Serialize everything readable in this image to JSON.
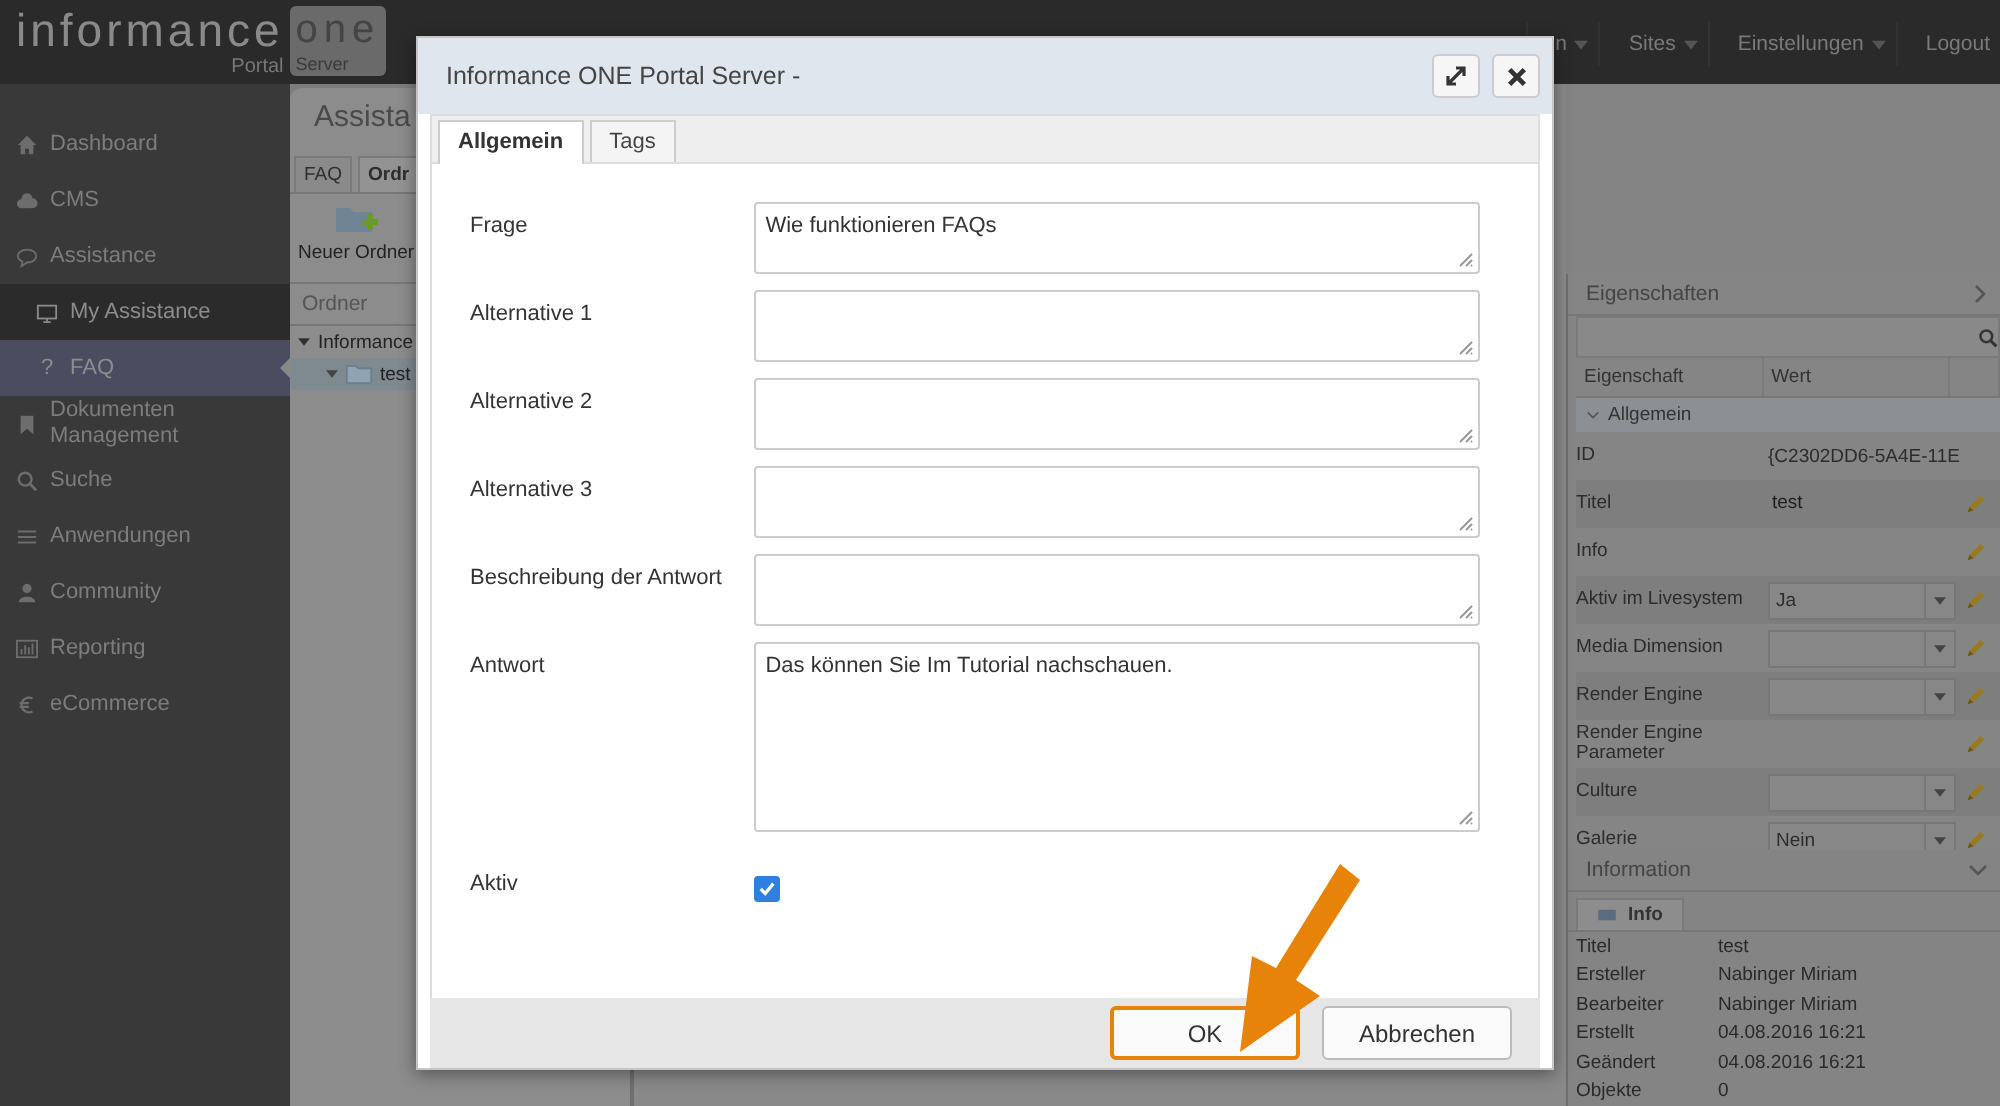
{
  "header": {
    "logo": {
      "brand": "informance",
      "one": "one",
      "portal": "Portal",
      "server": "Server"
    },
    "nav": [
      {
        "label": "n",
        "dropdown": true
      },
      {
        "label": "Sites",
        "dropdown": true
      },
      {
        "label": "Einstellungen",
        "dropdown": true
      },
      {
        "label": "Logout",
        "dropdown": false
      }
    ]
  },
  "sidebar": {
    "items": [
      {
        "label": "Dashboard",
        "selected": false
      },
      {
        "label": "CMS",
        "selected": false
      },
      {
        "label": "Assistance",
        "selected": false,
        "children": [
          {
            "label": "My Assistance",
            "selected": false
          },
          {
            "label": "FAQ",
            "icon_text": "?",
            "selected": true
          }
        ]
      },
      {
        "label": "Dokumenten Management",
        "selected": false
      },
      {
        "label": "Suche",
        "selected": false
      },
      {
        "label": "Anwendungen",
        "selected": false
      },
      {
        "label": "Community",
        "selected": false
      },
      {
        "label": "Reporting",
        "selected": false
      },
      {
        "label": "eCommerce",
        "selected": false
      }
    ]
  },
  "module": {
    "title": "Assista",
    "tabs": [
      {
        "label": "FAQ",
        "selected": false
      },
      {
        "label": "Ordr",
        "selected": true
      }
    ],
    "toolbar": [
      {
        "label": "Neuer Ordner"
      }
    ],
    "tree_header": "Ordner",
    "tree": [
      {
        "label": "Informance",
        "expanded": true,
        "selected": false,
        "children": [
          {
            "label": "test",
            "expanded": true,
            "selected": true
          }
        ]
      }
    ]
  },
  "properties": {
    "title": "Eigenschaften",
    "columns": [
      "Eigenschaft",
      "Wert"
    ],
    "group": {
      "label": "Allgemein",
      "expanded": true
    },
    "rows": [
      {
        "name": "ID",
        "kind": "text",
        "value": "{C2302DD6-5A4E-11E"
      },
      {
        "name": "Titel",
        "kind": "input",
        "value": "test"
      },
      {
        "name": "Info",
        "kind": "edit"
      },
      {
        "name": "Aktiv im Livesystem",
        "kind": "select",
        "value": "Ja"
      },
      {
        "name": "Media Dimension",
        "kind": "select"
      },
      {
        "name": "Render Engine",
        "kind": "select"
      },
      {
        "name": "Render Engine Parameter",
        "kind": "edit"
      },
      {
        "name": "Culture",
        "kind": "select"
      },
      {
        "name": "Galerie",
        "kind": "select",
        "value": "Nein"
      }
    ]
  },
  "information": {
    "title": "Information",
    "tab": "Info",
    "rows": [
      {
        "label": "Titel",
        "value": "test"
      },
      {
        "label": "Ersteller",
        "value": "Nabinger Miriam"
      },
      {
        "label": "Bearbeiter",
        "value": "Nabinger Miriam"
      },
      {
        "label": "Erstellt",
        "value": "04.08.2016 16:21"
      },
      {
        "label": "Geändert",
        "value": "04.08.2016 16:21"
      },
      {
        "label": "Objekte",
        "value": "0"
      }
    ]
  },
  "dialog": {
    "title": "Informance ONE Portal Server -",
    "tabs": [
      {
        "label": "Allgemein",
        "selected": true
      },
      {
        "label": "Tags",
        "selected": false
      }
    ],
    "fields": [
      {
        "label": "Frage",
        "kind": "textarea",
        "value": "Wie funktionieren FAQs"
      },
      {
        "label": "Alternative 1",
        "kind": "textarea"
      },
      {
        "label": "Alternative 2",
        "kind": "textarea"
      },
      {
        "label": "Alternative 3",
        "kind": "textarea"
      },
      {
        "label": "Beschreibung der Antwort",
        "kind": "textarea"
      },
      {
        "label": "Antwort",
        "kind": "tall",
        "value": "Das können Sie Im Tutorial nachschauen."
      },
      {
        "label": "Aktiv",
        "kind": "checkbox",
        "checked": true
      }
    ],
    "buttons": [
      {
        "label": "OK",
        "highlighted": true
      },
      {
        "label": "Abbrechen",
        "highlighted": false
      }
    ]
  }
}
